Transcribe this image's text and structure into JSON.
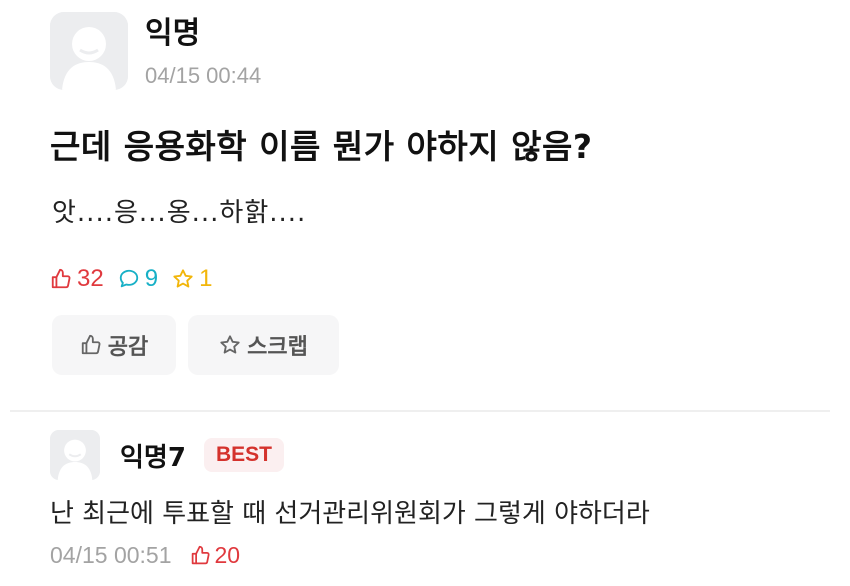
{
  "post": {
    "author": "익명",
    "timestamp": "04/15 00:44",
    "title": "근데 응용화학 이름 뭔가 야하지 않음?",
    "body": "앗....응...옹...하핡....",
    "stats": {
      "likes": "32",
      "comments": "9",
      "scraps": "1"
    },
    "actions": {
      "like_label": "공감",
      "scrap_label": "스크랩"
    }
  },
  "comment": {
    "author": "익명7",
    "badge": "BEST",
    "text": "난 최근에 투표할 때 선거관리위원회가 그렇게 야하더라",
    "timestamp": "04/15 00:51",
    "likes": "20"
  },
  "colors": {
    "like": "#e0393e",
    "comment": "#17b0c6",
    "scrap": "#f2b60a",
    "badge_bg": "#fbeff0",
    "badge_text": "#d4322c"
  },
  "icons": {
    "avatar": "default-avatar-icon",
    "like": "thumbs-up-icon",
    "comment": "speech-bubble-icon",
    "scrap": "star-icon"
  }
}
